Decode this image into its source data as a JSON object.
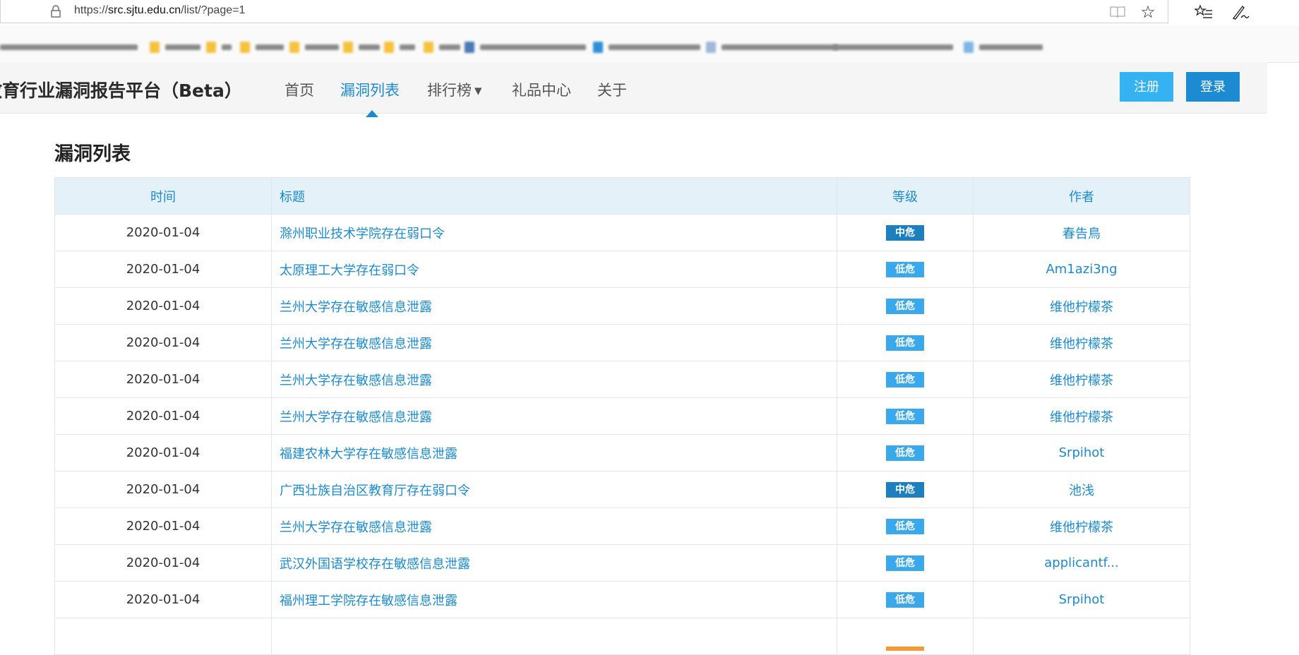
{
  "browser": {
    "url_prefix": "https://",
    "url_host": "src.sjtu.edu.cn",
    "url_path": "/list/?page=1",
    "icons": [
      "reading-view-icon",
      "favorite-star-icon",
      "favorites-hub-icon",
      "pen-icon"
    ]
  },
  "site": {
    "brand": "教育行业漏洞报告平台（Beta）",
    "nav": [
      "首页",
      "漏洞列表",
      "排行榜",
      "礼品中心",
      "关于"
    ],
    "dropdown_caret": "▾",
    "register": "注册",
    "login": "登录"
  },
  "page": {
    "title": "漏洞列表"
  },
  "table": {
    "headers": {
      "time": "时间",
      "title": "标题",
      "level": "等级",
      "author": "作者"
    },
    "rows": [
      {
        "time": "2020-01-04",
        "title": "滁州职业技术学院存在弱口令",
        "level": "中危",
        "level_kind": "mid",
        "author": "春告鳥"
      },
      {
        "time": "2020-01-04",
        "title": "太原理工大学存在弱口令",
        "level": "低危",
        "level_kind": "low",
        "author": "Am1azi3ng"
      },
      {
        "time": "2020-01-04",
        "title": "兰州大学存在敏感信息泄露",
        "level": "低危",
        "level_kind": "low",
        "author": "维他柠檬茶"
      },
      {
        "time": "2020-01-04",
        "title": "兰州大学存在敏感信息泄露",
        "level": "低危",
        "level_kind": "low",
        "author": "维他柠檬茶"
      },
      {
        "time": "2020-01-04",
        "title": "兰州大学存在敏感信息泄露",
        "level": "低危",
        "level_kind": "low",
        "author": "维他柠檬茶"
      },
      {
        "time": "2020-01-04",
        "title": "兰州大学存在敏感信息泄露",
        "level": "低危",
        "level_kind": "low",
        "author": "维他柠檬茶"
      },
      {
        "time": "2020-01-04",
        "title": "福建农林大学存在敏感信息泄露",
        "level": "低危",
        "level_kind": "low",
        "author": "Srpihot"
      },
      {
        "time": "2020-01-04",
        "title": "广西壮族自治区教育厅存在弱口令",
        "level": "中危",
        "level_kind": "mid",
        "author": "池浅"
      },
      {
        "time": "2020-01-04",
        "title": "兰州大学存在敏感信息泄露",
        "level": "低危",
        "level_kind": "low",
        "author": "维他柠檬茶"
      },
      {
        "time": "2020-01-04",
        "title": "武汉外国语学校存在敏感信息泄露",
        "level": "低危",
        "level_kind": "low",
        "author": "applicantf..."
      },
      {
        "time": "2020-01-04",
        "title": "福州理工学院存在敏感信息泄露",
        "level": "低危",
        "level_kind": "low",
        "author": "Srpihot"
      }
    ]
  },
  "colors": {
    "accent": "#1a8bd1",
    "badge_mid": "#1c7fc0",
    "badge_low": "#3aa8ec",
    "badge_high": "#f29a33",
    "header_bg": "#e4f1f9"
  }
}
